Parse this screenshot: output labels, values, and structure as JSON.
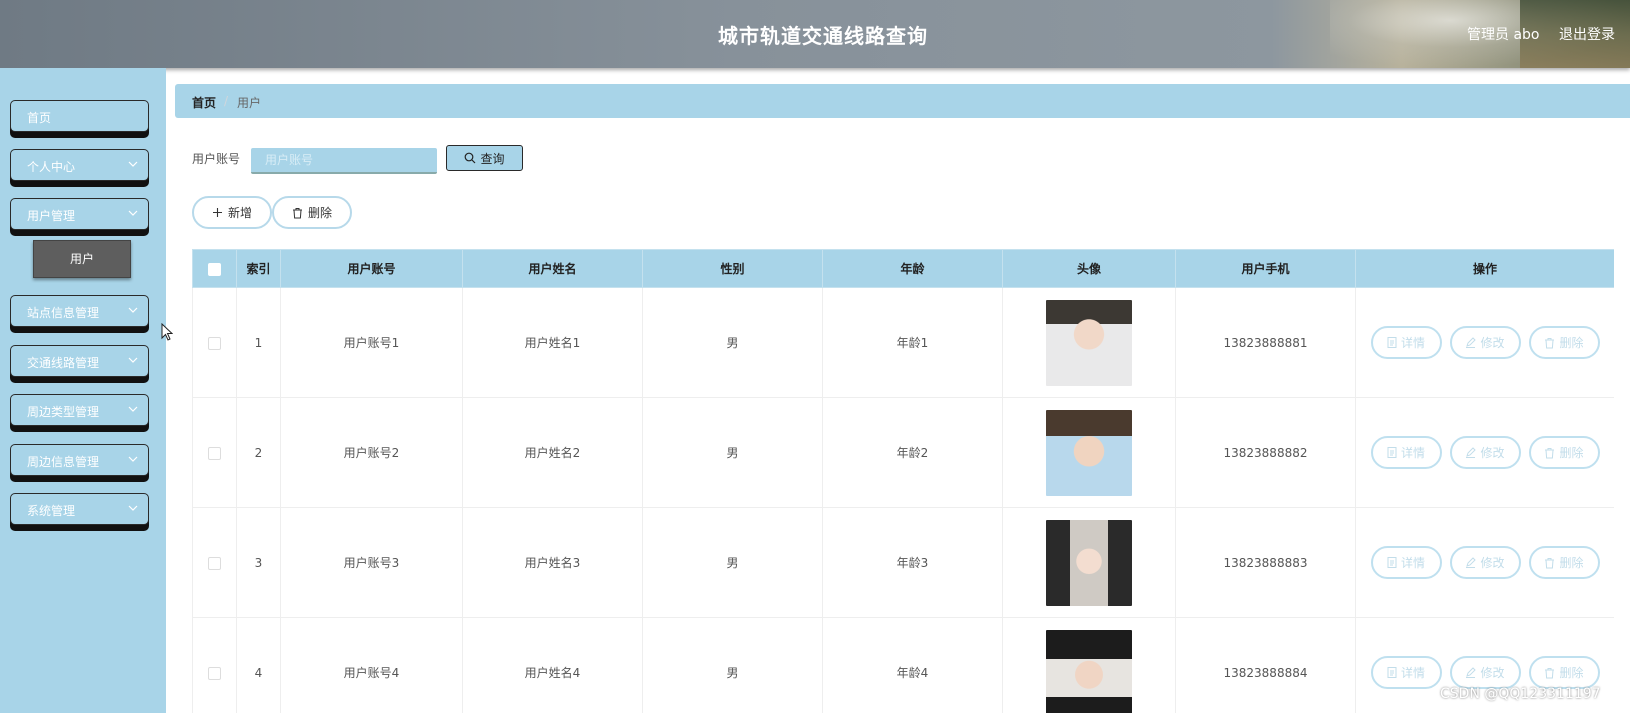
{
  "header": {
    "title": "城市轨道交通线路查询",
    "admin_label": "管理员 abo",
    "logout_label": "退出登录"
  },
  "sidebar": {
    "items": [
      {
        "label": "首页",
        "has_children": false
      },
      {
        "label": "个人中心",
        "has_children": true
      },
      {
        "label": "用户管理",
        "has_children": true,
        "expanded": true
      },
      {
        "label": "站点信息管理",
        "has_children": true
      },
      {
        "label": "交通线路管理",
        "has_children": true
      },
      {
        "label": "周边类型管理",
        "has_children": true
      },
      {
        "label": "周边信息管理",
        "has_children": true
      },
      {
        "label": "系统管理",
        "has_children": true
      }
    ],
    "submenu": {
      "label": "用户",
      "active": true
    }
  },
  "breadcrumb": {
    "home": "首页",
    "separator": "/",
    "current": "用户"
  },
  "search": {
    "label": "用户账号",
    "placeholder": "用户账号",
    "value": "",
    "button": "查询"
  },
  "actions": {
    "add": "新增",
    "delete": "删除"
  },
  "table": {
    "headers": [
      "索引",
      "用户账号",
      "用户姓名",
      "性别",
      "年龄",
      "头像",
      "用户手机",
      "操作"
    ],
    "rows": [
      {
        "index": "1",
        "account": "用户账号1",
        "name": "用户姓名1",
        "gender": "男",
        "age": "年龄1",
        "phone": "13823888881"
      },
      {
        "index": "2",
        "account": "用户账号2",
        "name": "用户姓名2",
        "gender": "男",
        "age": "年龄2",
        "phone": "13823888882"
      },
      {
        "index": "3",
        "account": "用户账号3",
        "name": "用户姓名3",
        "gender": "男",
        "age": "年龄3",
        "phone": "13823888883"
      },
      {
        "index": "4",
        "account": "用户账号4",
        "name": "用户姓名4",
        "gender": "男",
        "age": "年龄4",
        "phone": "13823888884"
      }
    ],
    "row_actions": {
      "detail": "详情",
      "edit": "修改",
      "delete": "删除"
    }
  },
  "watermark": "CSDN @QQ123311197",
  "colors": {
    "accent": "#a8d4e8",
    "submenu_active": "#5e5e5e",
    "header": "#87919a",
    "outline": "#bfe0ef"
  }
}
